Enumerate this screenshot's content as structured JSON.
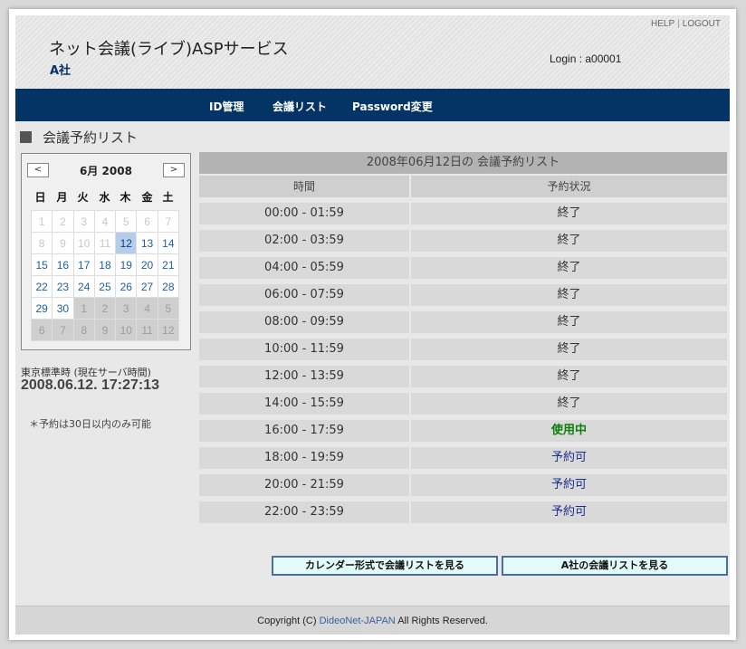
{
  "header": {
    "help": "HELP",
    "separator": "|",
    "logout": "LOGOUT",
    "site_title": "ネット会議(ライブ)ASPサービス",
    "company": "A社",
    "login": "Login : a00001"
  },
  "nav": {
    "items": [
      "ID管理",
      "会議リスト",
      "Password変更"
    ]
  },
  "section_title": "会議予約リスト",
  "calendar": {
    "prev": "<",
    "next": ">",
    "title": "6月 2008",
    "weekdays": [
      "日",
      "月",
      "火",
      "水",
      "木",
      "金",
      "土"
    ],
    "weeks": [
      [
        "1",
        "2",
        "3",
        "4",
        "5",
        "6",
        "7"
      ],
      [
        "8",
        "9",
        "10",
        "11",
        "12",
        "13",
        "14"
      ],
      [
        "15",
        "16",
        "17",
        "18",
        "19",
        "20",
        "21"
      ],
      [
        "22",
        "23",
        "24",
        "25",
        "26",
        "27",
        "28"
      ],
      [
        "29",
        "30",
        "1",
        "2",
        "3",
        "4",
        "5"
      ],
      [
        "6",
        "7",
        "8",
        "9",
        "10",
        "11",
        "12"
      ]
    ],
    "selected_day": "12"
  },
  "clock": {
    "label": "東京標準時 (現在サーバ時間)",
    "value": "2008.06.12. 17:27:13"
  },
  "note": "＊予約は30日以内のみ可能",
  "reservations": {
    "caption": "2008年06月12日の 会議予約リスト",
    "columns": [
      "時間",
      "予約状況"
    ],
    "rows": [
      {
        "time": "00:00 - 01:59",
        "status": "終了",
        "state": "ended"
      },
      {
        "time": "02:00 - 03:59",
        "status": "終了",
        "state": "ended"
      },
      {
        "time": "04:00 - 05:59",
        "status": "終了",
        "state": "ended"
      },
      {
        "time": "06:00 - 07:59",
        "status": "終了",
        "state": "ended"
      },
      {
        "time": "08:00 - 09:59",
        "status": "終了",
        "state": "ended"
      },
      {
        "time": "10:00 - 11:59",
        "status": "終了",
        "state": "ended"
      },
      {
        "time": "12:00 - 13:59",
        "status": "終了",
        "state": "ended"
      },
      {
        "time": "14:00 - 15:59",
        "status": "終了",
        "state": "ended"
      },
      {
        "time": "16:00 - 17:59",
        "status": "使用中",
        "state": "inuse"
      },
      {
        "time": "18:00 - 19:59",
        "status": "予約可",
        "state": "avail"
      },
      {
        "time": "20:00 - 21:59",
        "status": "予約可",
        "state": "avail"
      },
      {
        "time": "22:00 - 23:59",
        "status": "予約可",
        "state": "avail"
      }
    ]
  },
  "buttons": {
    "calendar_view": "カレンダー形式で会議リストを見る",
    "company_list": "A社の会議リストを見る"
  },
  "footer": {
    "prefix": "Copyright (C) ",
    "brand": "DideoNet-JAPAN",
    "suffix": " All Rights Reserved."
  },
  "colors": {
    "nav_bg": "#043466",
    "in_use": "#0a7f0a",
    "available": "#1a2f8f",
    "today_bg": "#b5cde8"
  }
}
